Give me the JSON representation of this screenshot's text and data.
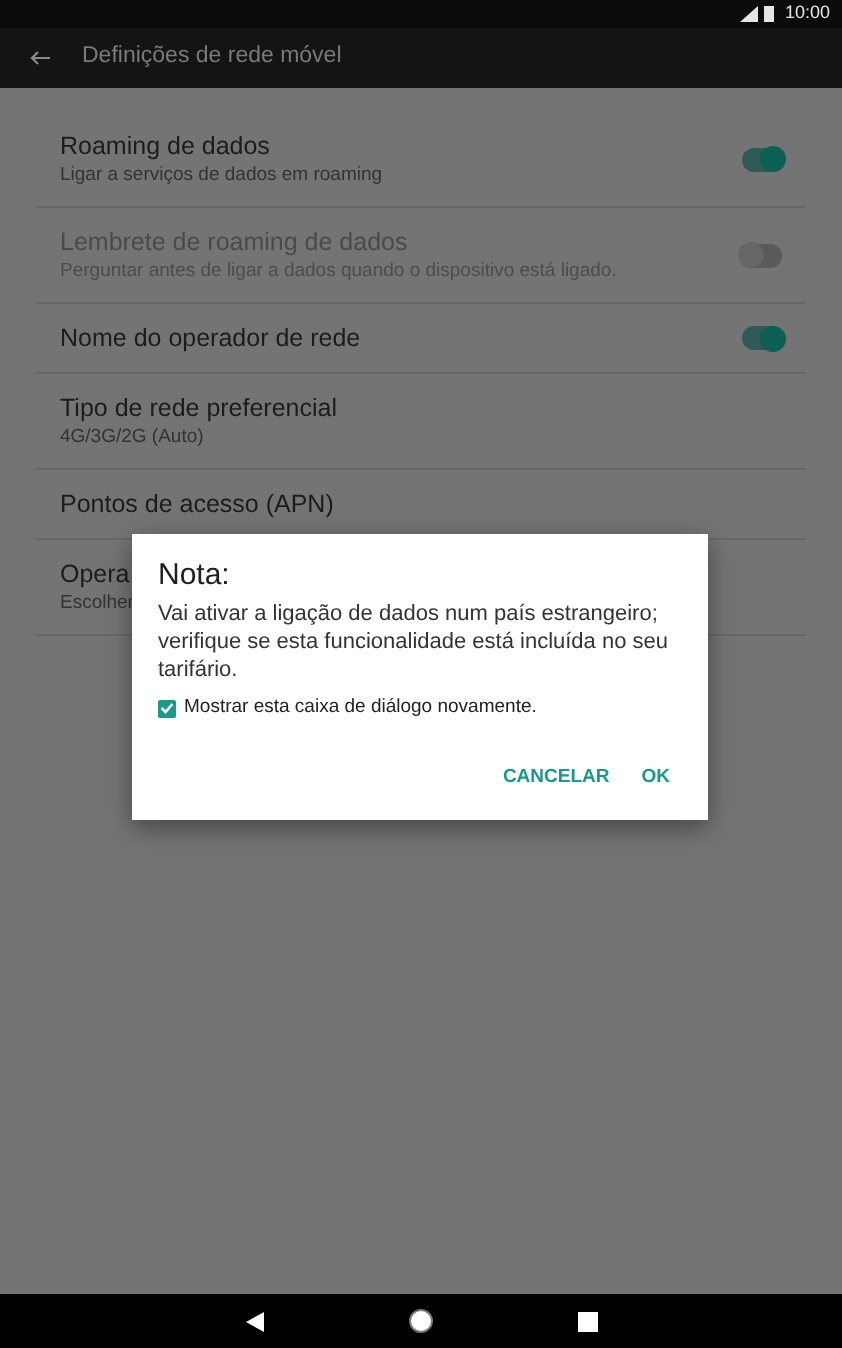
{
  "status_bar": {
    "time": "10:00"
  },
  "toolbar": {
    "title": "Definições de rede móvel"
  },
  "settings": [
    {
      "kind": "toggle",
      "title": "Roaming de dados",
      "subtitle": "Ligar a serviços de dados em roaming",
      "on": true,
      "disabled": false
    },
    {
      "kind": "toggle",
      "title": "Lembrete de roaming de dados",
      "subtitle": "Perguntar antes de ligar a dados quando o dispositivo está ligado.",
      "on": false,
      "disabled": true
    },
    {
      "kind": "toggle",
      "title": "Nome do operador de rede",
      "on": true,
      "disabled": false
    },
    {
      "kind": "link",
      "title": "Tipo de rede preferencial",
      "subtitle": "4G/3G/2G (Auto)"
    },
    {
      "kind": "link",
      "title": "Pontos de acesso (APN)"
    },
    {
      "kind": "link",
      "title": "Opera",
      "subtitle": "Escolher"
    }
  ],
  "dialog": {
    "title": "Nota:",
    "message": "Vai ativar a ligação de dados num país estrangeiro; verifique se esta funcionalidade está incluída no seu tarifário.",
    "checkbox": {
      "label": "Mostrar esta caixa de diálogo novamente.",
      "checked": true
    },
    "buttons": [
      "CANCELAR",
      "OK"
    ]
  }
}
